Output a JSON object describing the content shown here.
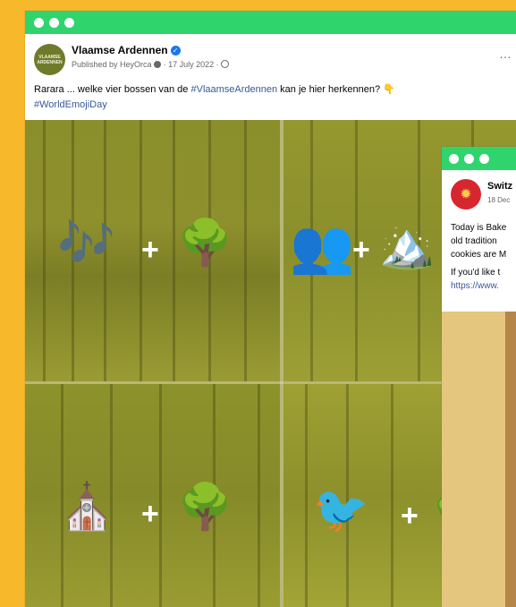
{
  "main_post": {
    "page_name": "Vlaamse Ardennen",
    "avatar_text": "VLAAMSE ARDENNEN",
    "published_by": "Published by HeyOrca",
    "date": "17 July 2022",
    "text_prefix": "Rarara ... welke vier bossen van de ",
    "hashtag_1": "#VlaamseArdennen",
    "text_suffix": " kan je hier herkennen? ",
    "hashtag_2": "#WorldEmojiDay",
    "more_icon": "…",
    "emoji_puzzles": [
      {
        "left": "🎶",
        "plus": "+",
        "right": "🌳"
      },
      {
        "left": "👥",
        "plus": "+",
        "right": "🏔️"
      },
      {
        "left": "⛪",
        "plus": "+",
        "right": "🌳"
      },
      {
        "left": "🐦",
        "plus": "+",
        "right": "🌳"
      }
    ]
  },
  "second_post": {
    "page_name": "Switz",
    "date": "18 Dec",
    "line_1": "Today is Bake",
    "line_2": "old tradition",
    "line_3": "cookies are M",
    "line_4": "If you'd like t",
    "link": "https://www."
  },
  "colors": {
    "background": "#f7b92b",
    "titlebar": "#2fd46d",
    "overlay": "#8f922e",
    "link": "#385898"
  }
}
